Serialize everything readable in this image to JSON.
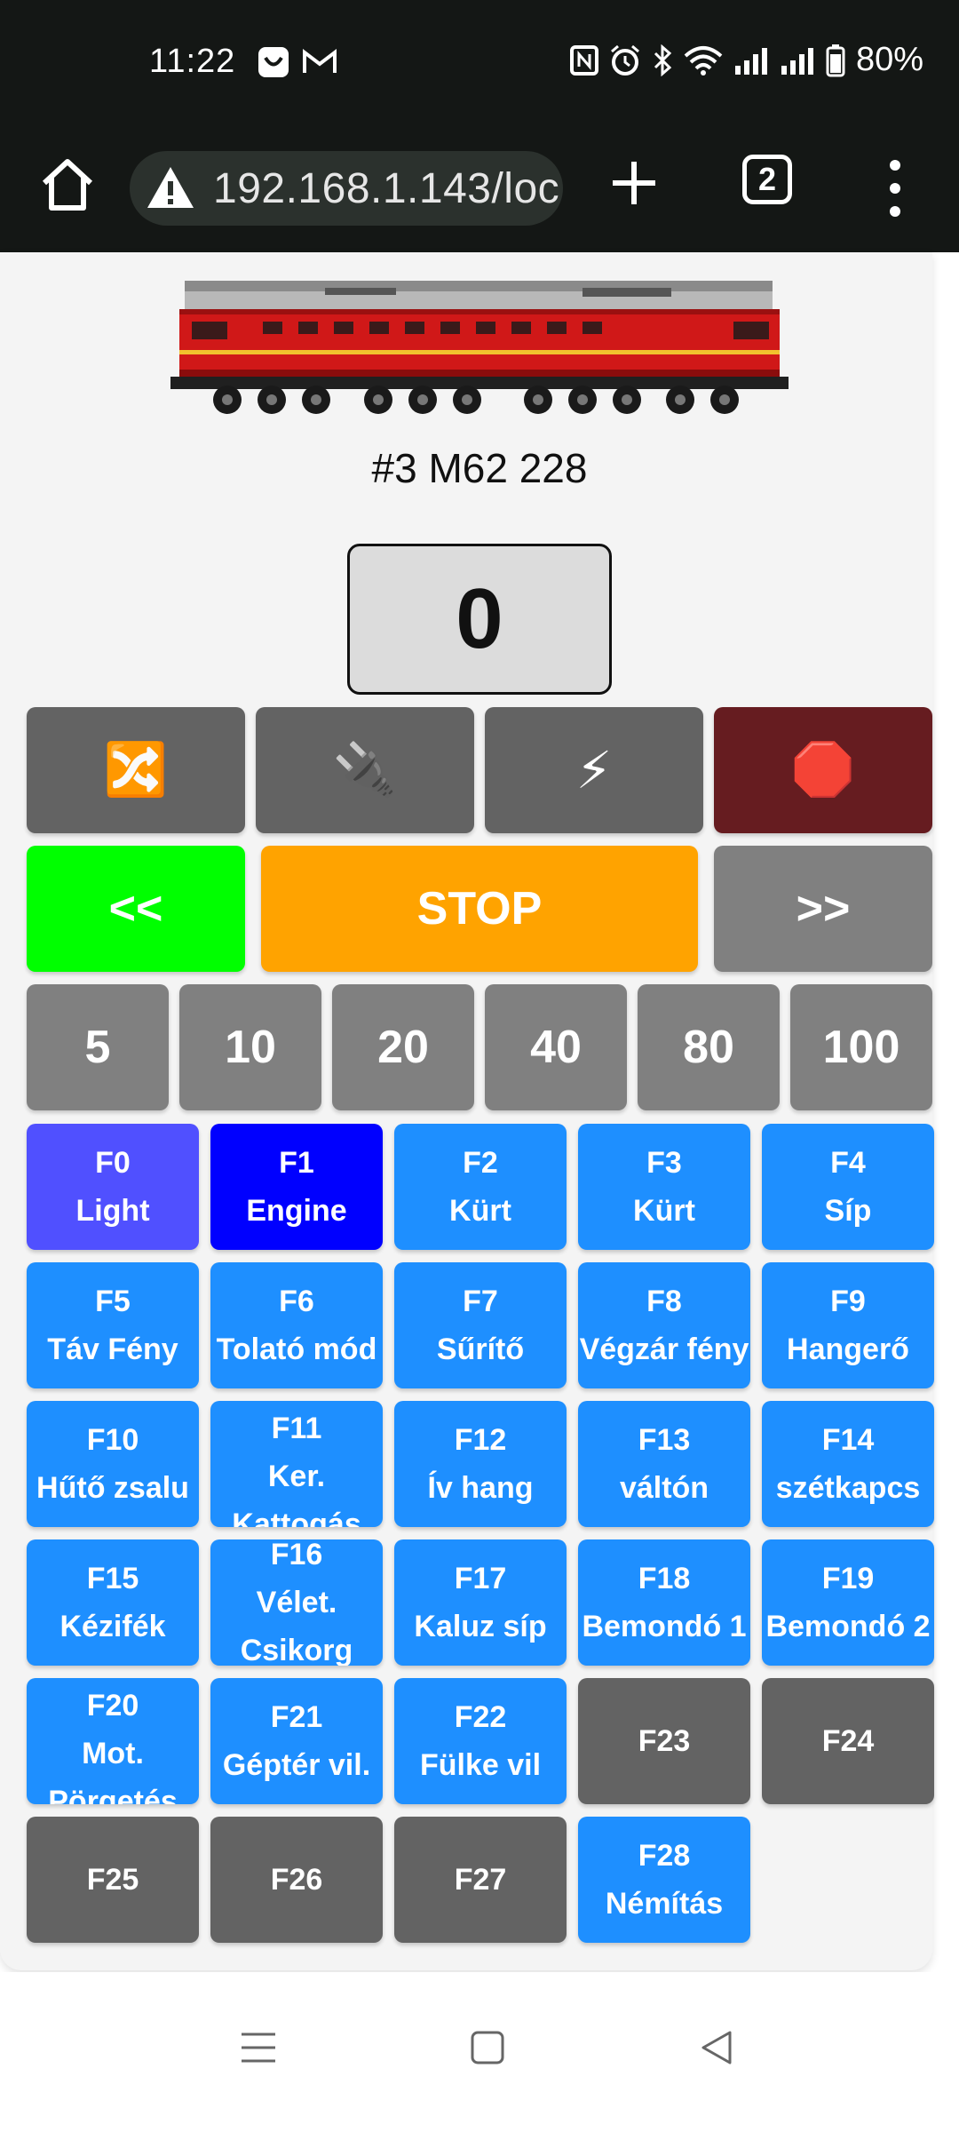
{
  "status_bar": {
    "time": "11:22",
    "battery": "80%",
    "icons": [
      "nfc-icon",
      "alarm-icon",
      "bluetooth-icon",
      "wifi-icon",
      "signal-icon",
      "signal-icon",
      "battery-icon"
    ]
  },
  "browser": {
    "url": "192.168.1.143/loc",
    "tab_count": "2"
  },
  "loco": {
    "name": "#3 M62 228",
    "speed": "0"
  },
  "controls": {
    "row1": [
      {
        "icon": "shuffle-icon",
        "glyph": "🔀",
        "color": "#636363"
      },
      {
        "icon": "plug-icon",
        "glyph": "🔌",
        "color": "#636363"
      },
      {
        "icon": "lightning-icon",
        "glyph": "⚡",
        "color": "#636363"
      },
      {
        "icon": "stop-sign-icon",
        "glyph": "🛑",
        "color": "#661c20"
      }
    ],
    "reverse_label": "<<",
    "stop_label": "STOP",
    "forward_label": ">>",
    "colors": {
      "reverse": "#00ff00",
      "stop": "#ffa300",
      "forward": "#808080"
    },
    "speed_presets": [
      "5",
      "10",
      "20",
      "40",
      "80",
      "100"
    ]
  },
  "functions": [
    {
      "num": "F0",
      "label": "Light",
      "color": "#5050ff"
    },
    {
      "num": "F1",
      "label": "Engine",
      "color": "#0000ff"
    },
    {
      "num": "F2",
      "label": "Kürt",
      "color": "#1e8fff"
    },
    {
      "num": "F3",
      "label": "Kürt",
      "color": "#1e8fff"
    },
    {
      "num": "F4",
      "label": "Síp",
      "color": "#1e8fff"
    },
    {
      "num": "F5",
      "label": "Táv Fény",
      "color": "#1e8fff"
    },
    {
      "num": "F6",
      "label": "Tolató mód",
      "color": "#1e8fff"
    },
    {
      "num": "F7",
      "label": "Sűrítő",
      "color": "#1e8fff"
    },
    {
      "num": "F8",
      "label": "Végzár fény",
      "color": "#1e8fff"
    },
    {
      "num": "F9",
      "label": "Hangerő",
      "color": "#1e8fff"
    },
    {
      "num": "F10",
      "label": "Hűtő zsalu",
      "color": "#1e8fff"
    },
    {
      "num": "F11",
      "label": "Ker. Kattogás",
      "color": "#1e8fff"
    },
    {
      "num": "F12",
      "label": "Ív hang",
      "color": "#1e8fff"
    },
    {
      "num": "F13",
      "label": "váltón",
      "color": "#1e8fff"
    },
    {
      "num": "F14",
      "label": "szétkapcs",
      "color": "#1e8fff"
    },
    {
      "num": "F15",
      "label": "Kézifék",
      "color": "#1e8fff"
    },
    {
      "num": "F16",
      "label": "Vélet. Csikorg",
      "color": "#1e8fff"
    },
    {
      "num": "F17",
      "label": "Kaluz síp",
      "color": "#1e8fff"
    },
    {
      "num": "F18",
      "label": "Bemondó 1",
      "color": "#1e8fff"
    },
    {
      "num": "F19",
      "label": "Bemondó 2",
      "color": "#1e8fff"
    },
    {
      "num": "F20",
      "label": "Mot. Pörgetés",
      "color": "#1e8fff"
    },
    {
      "num": "F21",
      "label": "Géptér vil.",
      "color": "#1e8fff"
    },
    {
      "num": "F22",
      "label": "Fülke vil",
      "color": "#1e8fff"
    },
    {
      "num": "F23",
      "label": "",
      "color": "#636363"
    },
    {
      "num": "F24",
      "label": "",
      "color": "#636363"
    },
    {
      "num": "F25",
      "label": "",
      "color": "#636363"
    },
    {
      "num": "F26",
      "label": "",
      "color": "#636363"
    },
    {
      "num": "F27",
      "label": "",
      "color": "#636363"
    },
    {
      "num": "F28",
      "label": "Némítás",
      "color": "#1e8fff"
    }
  ],
  "nav_bar": {
    "icons": [
      "recents-icon",
      "home-icon",
      "back-icon"
    ]
  }
}
